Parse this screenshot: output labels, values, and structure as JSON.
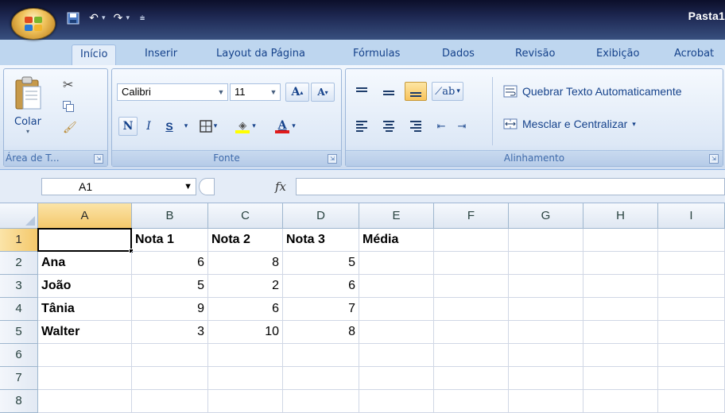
{
  "title_bar": {
    "document_title": "Pasta1"
  },
  "tabs": [
    "Início",
    "Inserir",
    "Layout da Página",
    "Fórmulas",
    "Dados",
    "Revisão",
    "Exibição",
    "Acrobat"
  ],
  "ribbon": {
    "clipboard": {
      "paste_label": "Colar",
      "group_label": "Área de T..."
    },
    "font": {
      "font_name": "Calibri",
      "font_size": "11",
      "bold": "N",
      "italic": "I",
      "underline": "S",
      "group_label": "Fonte"
    },
    "alignment": {
      "wrap_label": "Quebrar Texto Automaticamente",
      "merge_label": "Mesclar e Centralizar",
      "group_label": "Alinhamento"
    }
  },
  "formula_bar": {
    "name_box": "A1",
    "fx": "fx",
    "formula": ""
  },
  "grid": {
    "columns": [
      "A",
      "B",
      "C",
      "D",
      "E",
      "F",
      "G",
      "H",
      "I"
    ],
    "rows": [
      "1",
      "2",
      "3",
      "4",
      "5",
      "6",
      "7",
      "8"
    ],
    "cells": [
      [
        "",
        "Nota 1",
        "Nota 2",
        "Nota 3",
        "Média",
        "",
        "",
        "",
        ""
      ],
      [
        "Ana",
        "6",
        "8",
        "5",
        "",
        "",
        "",
        "",
        ""
      ],
      [
        "João",
        "5",
        "2",
        "6",
        "",
        "",
        "",
        "",
        ""
      ],
      [
        "Tânia",
        "9",
        "6",
        "7",
        "",
        "",
        "",
        "",
        ""
      ],
      [
        "Walter",
        "3",
        "10",
        "8",
        "",
        "",
        "",
        "",
        ""
      ],
      [
        "",
        "",
        "",
        "",
        "",
        "",
        "",
        "",
        ""
      ],
      [
        "",
        "",
        "",
        "",
        "",
        "",
        "",
        "",
        ""
      ],
      [
        "",
        "",
        "",
        "",
        "",
        "",
        "",
        "",
        ""
      ]
    ],
    "active_cell": "A1"
  },
  "colors": {
    "accent_selected": "#f4c86b",
    "ribbon_text": "#15428b",
    "font_color_bar": "#e01b1b",
    "highlight_bar": "#ffff00"
  }
}
